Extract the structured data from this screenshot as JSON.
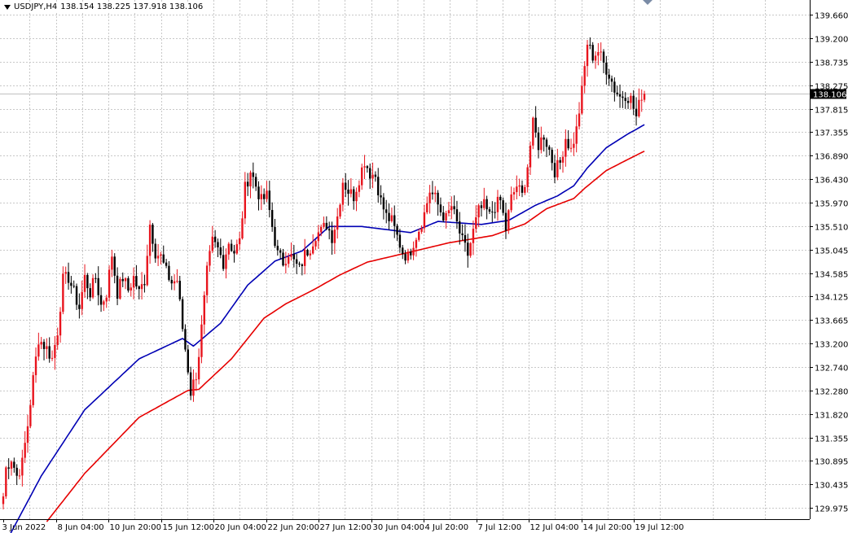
{
  "header": {
    "symbol": "USDJPY,H4",
    "ohlc": "138.154 138.225 137.918 138.106"
  },
  "price_tag": "138.106",
  "colors": {
    "bull": "#e8141d",
    "bear": "#000000",
    "ma_fast": "#0000b4",
    "ma_slow": "#e60000",
    "grid": "#c8c8c8",
    "price_line": "#c0c0c0"
  },
  "chart_data": {
    "type": "candlestick",
    "title": "USDJPY,H4",
    "ylim": [
      129.75,
      139.95
    ],
    "y_ticks": [
      "139.660",
      "139.200",
      "138.735",
      "138.275",
      "137.815",
      "137.355",
      "136.890",
      "136.430",
      "135.970",
      "135.510",
      "135.045",
      "134.585",
      "134.125",
      "133.665",
      "133.200",
      "132.740",
      "132.280",
      "131.820",
      "131.355",
      "130.895",
      "130.435",
      "129.975"
    ],
    "x_ticks": [
      "3 Jun 2022",
      "8 Jun 04:00",
      "10 Jun 20:00",
      "15 Jun 12:00",
      "20 Jun 04:00",
      "22 Jun 20:00",
      "27 Jun 12:00",
      "30 Jun 04:00",
      "4 Jul 20:00",
      "7 Jul 12:00",
      "12 Jul 04:00",
      "14 Jul 20:00",
      "19 Jul 12:00"
    ],
    "grid": true,
    "last_price": 138.106,
    "anchors": [
      [
        0,
        130.2
      ],
      [
        1,
        130.75
      ],
      [
        3,
        130.95
      ],
      [
        5,
        130.6
      ],
      [
        7,
        130.85
      ],
      [
        9,
        131.6
      ],
      [
        11,
        132.5
      ],
      [
        13,
        133.3
      ],
      [
        16,
        133.1
      ],
      [
        18,
        132.9
      ],
      [
        20,
        133.45
      ],
      [
        22,
        134.45
      ],
      [
        24,
        134.5
      ],
      [
        26,
        134.2
      ],
      [
        28,
        133.9
      ],
      [
        30,
        134.5
      ],
      [
        32,
        134.2
      ],
      [
        34,
        134.5
      ],
      [
        36,
        133.95
      ],
      [
        38,
        134.2
      ],
      [
        40,
        134.95
      ],
      [
        42,
        134.2
      ],
      [
        44,
        134.5
      ],
      [
        46,
        134.25
      ],
      [
        48,
        134.5
      ],
      [
        50,
        134.2
      ],
      [
        52,
        134.45
      ],
      [
        54,
        135.55
      ],
      [
        56,
        135.0
      ],
      [
        58,
        134.9
      ],
      [
        60,
        134.6
      ],
      [
        62,
        134.4
      ],
      [
        64,
        134.45
      ],
      [
        66,
        133.5
      ],
      [
        68,
        132.7
      ],
      [
        69,
        132.25
      ],
      [
        71,
        132.6
      ],
      [
        72,
        133.0
      ],
      [
        73,
        133.5
      ],
      [
        75,
        134.6
      ],
      [
        77,
        135.2
      ],
      [
        79,
        135.05
      ],
      [
        81,
        134.8
      ],
      [
        83,
        135.2
      ],
      [
        85,
        135.0
      ],
      [
        87,
        135.2
      ],
      [
        89,
        136.25
      ],
      [
        91,
        136.6
      ],
      [
        93,
        136.3
      ],
      [
        95,
        136.0
      ],
      [
        97,
        136.1
      ],
      [
        99,
        135.5
      ],
      [
        101,
        134.95
      ],
      [
        103,
        134.8
      ],
      [
        105,
        135.0
      ],
      [
        107,
        134.8
      ],
      [
        109,
        134.65
      ],
      [
        111,
        134.95
      ],
      [
        113,
        135.1
      ],
      [
        115,
        135.35
      ],
      [
        117,
        135.4
      ],
      [
        119,
        135.55
      ],
      [
        121,
        135.3
      ],
      [
        123,
        135.7
      ],
      [
        125,
        136.4
      ],
      [
        127,
        136.2
      ],
      [
        129,
        136.1
      ],
      [
        131,
        136.45
      ],
      [
        133,
        136.8
      ],
      [
        135,
        136.55
      ],
      [
        137,
        136.5
      ],
      [
        139,
        136.0
      ],
      [
        141,
        135.7
      ],
      [
        143,
        135.6
      ],
      [
        145,
        135.3
      ],
      [
        147,
        135.0
      ],
      [
        149,
        134.9
      ],
      [
        151,
        135.2
      ],
      [
        153,
        135.45
      ],
      [
        155,
        135.75
      ],
      [
        157,
        136.2
      ],
      [
        159,
        136.05
      ],
      [
        161,
        135.8
      ],
      [
        163,
        135.65
      ],
      [
        165,
        135.9
      ],
      [
        167,
        135.55
      ],
      [
        169,
        135.2
      ],
      [
        171,
        134.95
      ],
      [
        173,
        135.4
      ],
      [
        175,
        135.8
      ],
      [
        177,
        135.9
      ],
      [
        179,
        135.7
      ],
      [
        181,
        135.9
      ],
      [
        183,
        136.0
      ],
      [
        185,
        135.45
      ],
      [
        187,
        136.05
      ],
      [
        189,
        136.3
      ],
      [
        191,
        136.1
      ],
      [
        193,
        136.7
      ],
      [
        195,
        137.5
      ],
      [
        197,
        137.1
      ],
      [
        199,
        137.3
      ],
      [
        201,
        137.0
      ],
      [
        203,
        136.6
      ],
      [
        205,
        136.75
      ],
      [
        207,
        137.25
      ],
      [
        209,
        137.0
      ],
      [
        211,
        137.4
      ],
      [
        213,
        138.15
      ],
      [
        215,
        139.1
      ],
      [
        217,
        138.85
      ],
      [
        219,
        138.95
      ],
      [
        221,
        138.7
      ],
      [
        223,
        138.5
      ],
      [
        225,
        138.2
      ],
      [
        227,
        138.05
      ],
      [
        229,
        138.1
      ],
      [
        231,
        138.0
      ],
      [
        233,
        137.65
      ],
      [
        235,
        138.1
      ],
      [
        236,
        138.106
      ]
    ],
    "ma_fast": [
      [
        0,
        129.2
      ],
      [
        14,
        130.6
      ],
      [
        30,
        131.9
      ],
      [
        50,
        132.9
      ],
      [
        66,
        133.3
      ],
      [
        70,
        133.15
      ],
      [
        80,
        133.6
      ],
      [
        90,
        134.35
      ],
      [
        100,
        134.82
      ],
      [
        110,
        135.02
      ],
      [
        120,
        135.5
      ],
      [
        132,
        135.5
      ],
      [
        150,
        135.38
      ],
      [
        160,
        135.6
      ],
      [
        176,
        135.54
      ],
      [
        186,
        135.62
      ],
      [
        196,
        135.92
      ],
      [
        204,
        136.1
      ],
      [
        210,
        136.3
      ],
      [
        215,
        136.65
      ],
      [
        222,
        137.05
      ],
      [
        230,
        137.32
      ],
      [
        236,
        137.5
      ]
    ],
    "ma_slow": [
      [
        16,
        129.7
      ],
      [
        30,
        130.65
      ],
      [
        50,
        131.75
      ],
      [
        68,
        132.28
      ],
      [
        72,
        132.3
      ],
      [
        84,
        132.9
      ],
      [
        96,
        133.7
      ],
      [
        104,
        133.98
      ],
      [
        114,
        134.25
      ],
      [
        124,
        134.55
      ],
      [
        134,
        134.8
      ],
      [
        150,
        135.0
      ],
      [
        164,
        135.18
      ],
      [
        180,
        135.32
      ],
      [
        192,
        135.55
      ],
      [
        200,
        135.85
      ],
      [
        210,
        136.05
      ],
      [
        214,
        136.25
      ],
      [
        222,
        136.6
      ],
      [
        230,
        136.82
      ],
      [
        236,
        136.98
      ]
    ]
  }
}
